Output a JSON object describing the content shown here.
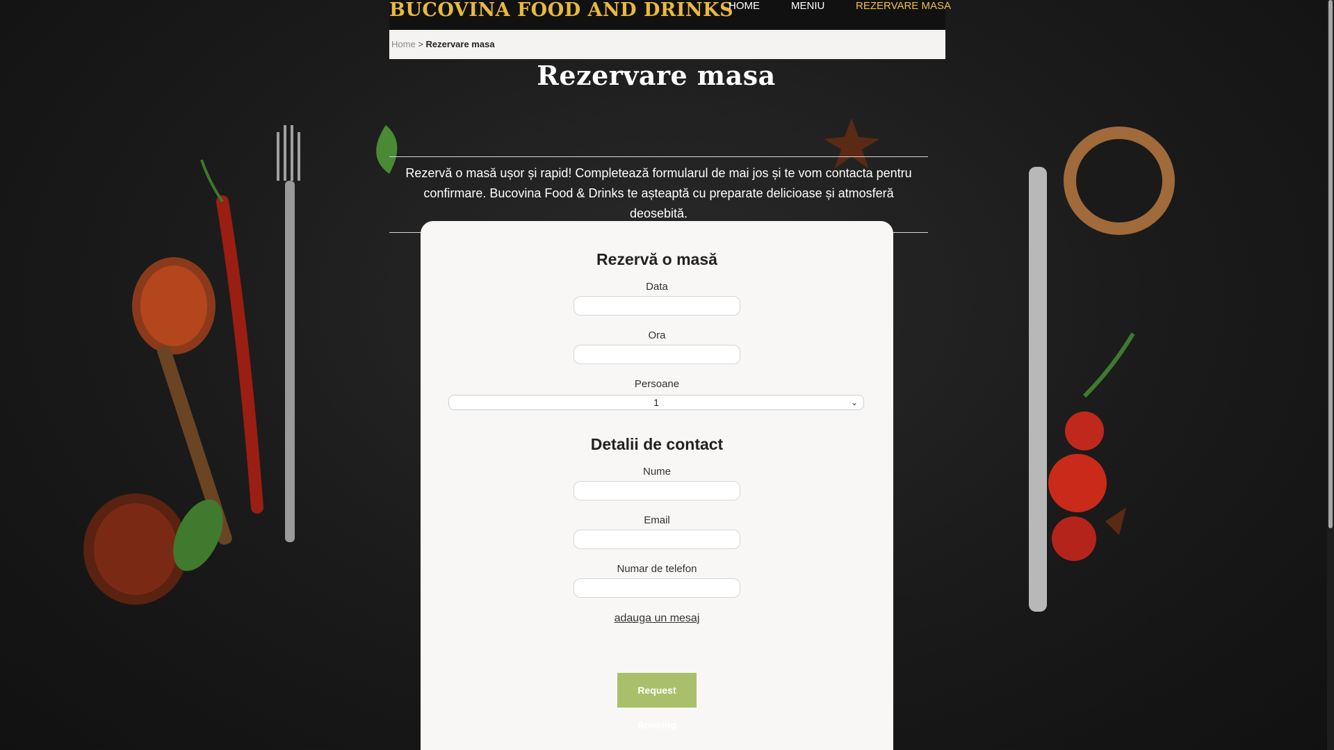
{
  "header": {
    "brand": "BUCOVINA FOOD AND DRINKS",
    "nav": [
      {
        "label": "HOME"
      },
      {
        "label": "MENIU"
      },
      {
        "label": "REZERVARE MASA",
        "active": true
      }
    ]
  },
  "breadcrumb": {
    "home": "Home",
    "separator": ">",
    "current": "Rezervare masa"
  },
  "page": {
    "title": "Rezervare masa",
    "intro": "Rezervă o masă ușor și rapid! Completează formularul de mai jos și te vom contacta pentru confirmare. Bucovina Food & Drinks te așteaptă cu preparate delicioase și atmosferă deosebită."
  },
  "form": {
    "heading": "Rezervă o masă",
    "date_label": "Data",
    "date_value": "",
    "time_label": "Ora",
    "time_value": "",
    "persons_label": "Persoane",
    "persons_value": "1",
    "contact_heading": "Detalii de contact",
    "name_label": "Nume",
    "name_value": "",
    "email_label": "Email",
    "email_value": "",
    "phone_label": "Numar de telefon",
    "phone_value": "",
    "message_link": "adauga un mesaj",
    "submit_label": "Request Booking"
  },
  "colors": {
    "brand": "#e8b93e",
    "nav_active": "#f0c04a",
    "button": "#a9c06a",
    "card": "#f8f7f6"
  }
}
